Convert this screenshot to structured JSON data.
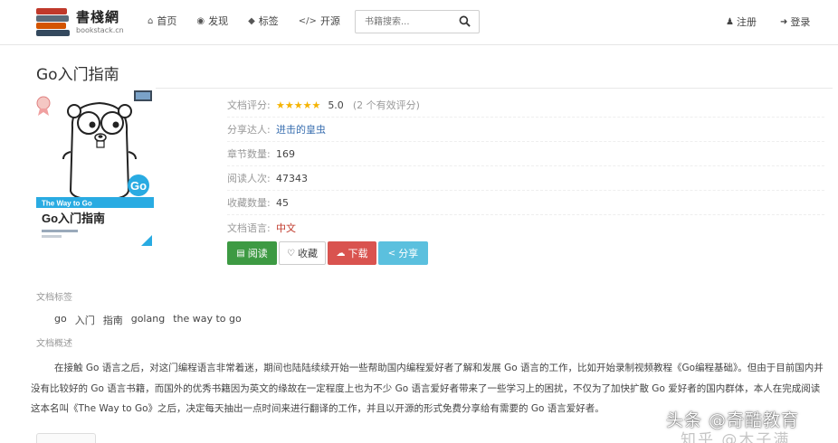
{
  "site": {
    "logo_cn": "書棧網",
    "logo_en": "bookstack.cn"
  },
  "nav": {
    "items": [
      {
        "label": "首页",
        "icon": "home-icon"
      },
      {
        "label": "发现",
        "icon": "compass-icon"
      },
      {
        "label": "标签",
        "icon": "tags-icon"
      },
      {
        "label": "开源",
        "icon": "code-icon"
      }
    ]
  },
  "search": {
    "placeholder": "书籍搜索..."
  },
  "auth": {
    "register": "注册",
    "login": "登录"
  },
  "book": {
    "title": "Go入门指南",
    "cover": {
      "badge": "Go",
      "banner": "The Way to Go",
      "cover_title": "Go入门指南"
    },
    "info": {
      "rating_label": "文档评分:",
      "rating_stars": "★★★★★",
      "rating_value": "5.0",
      "rating_count": "(2 个有效评分)",
      "sharer_label": "分享达人:",
      "sharer_value": "进击的皇虫",
      "chapters_label": "章节数量:",
      "chapters_value": "169",
      "reads_label": "阅读人次:",
      "reads_value": "47343",
      "favs_label": "收藏数量:",
      "favs_value": "45",
      "lang_label": "文档语言:",
      "lang_value": "中文"
    },
    "buttons": {
      "read": "阅读",
      "favorite": "收藏",
      "download": "下载",
      "share": "分享"
    },
    "tags_label": "文档标签",
    "tags": [
      "go",
      "入门",
      "指南",
      "golang",
      "the way to go"
    ],
    "summary_label": "文档概述",
    "summary": "在接触 Go 语言之后，对这门编程语言非常着迷，期间也陆陆续续开始一些帮助国内编程爱好者了解和发展 Go 语言的工作，比如开始录制视频教程《Go编程基础》。但由于目前国内并没有比较好的 Go 语言书籍，而国外的优秀书籍因为英文的缘故在一定程度上也为不少 Go 语言爱好者带来了一些学习上的困扰，不仅为了加快扩散 Go 爱好者的国内群体，本人在完成阅读这本名叫《The Way to Go》之后，决定每天抽出一点时间来进行翻译的工作，并且以开源的形式免费分享给有需要的 Go 语言爱好者。"
  },
  "watermarks": {
    "toutiao": "头条 @奇酷教育",
    "zhihu": "知乎 @木子满"
  },
  "colors": {
    "read": "#3d9a43",
    "download": "#d9534f",
    "share": "#5bc0de",
    "star": "#f5b301",
    "link": "#3a6fb0"
  }
}
